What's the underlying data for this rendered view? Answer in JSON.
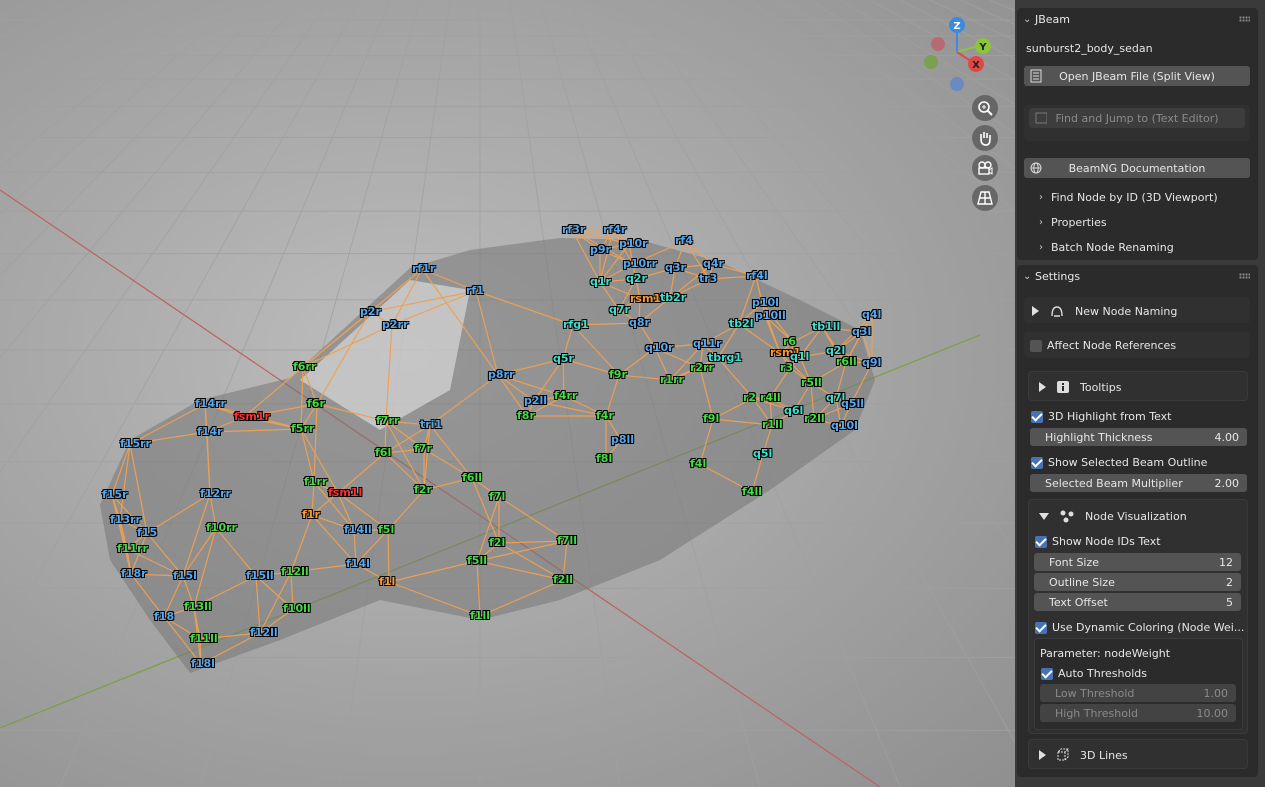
{
  "viewport": {
    "gizmo": {
      "z": "Z",
      "y": "Y",
      "x": "X"
    },
    "node_labels": [
      {
        "t": "rf3r",
        "c": "#58a8f0"
      },
      {
        "t": "rf4r",
        "c": "#58a8f0"
      },
      {
        "t": "p9r",
        "c": "#58a8f0"
      },
      {
        "t": "p10r",
        "c": "#58a8f0"
      },
      {
        "t": "rf4",
        "c": "#58a8f0"
      },
      {
        "t": "rf1r",
        "c": "#58a8f0"
      },
      {
        "t": "p10rr",
        "c": "#58a8f0"
      },
      {
        "t": "q4r",
        "c": "#58a8f0"
      },
      {
        "t": "q3r",
        "c": "#58a8f0"
      },
      {
        "t": "q1r",
        "c": "#40e0d0"
      },
      {
        "t": "q2r",
        "c": "#40e0d0"
      },
      {
        "t": "tr3",
        "c": "#58a8f0"
      },
      {
        "t": "rf4l",
        "c": "#58a8f0"
      },
      {
        "t": "rf1",
        "c": "#58a8f0"
      },
      {
        "t": "rsm1",
        "c": "#ff9a30"
      },
      {
        "t": "tb2r",
        "c": "#40e0d0"
      },
      {
        "t": "p10l",
        "c": "#58a8f0"
      },
      {
        "t": "p2r",
        "c": "#58a8f0"
      },
      {
        "t": "p2rr",
        "c": "#58a8f0"
      },
      {
        "t": "q7r",
        "c": "#40e0d0"
      },
      {
        "t": "rfg1",
        "c": "#40e0d0"
      },
      {
        "t": "q8r",
        "c": "#58a8f0"
      },
      {
        "t": "p10ll",
        "c": "#58a8f0"
      },
      {
        "t": "tb2l",
        "c": "#40e0d0"
      },
      {
        "t": "tb1ll",
        "c": "#40e0d0"
      },
      {
        "t": "q4l",
        "c": "#58a8f0"
      },
      {
        "t": "q3l",
        "c": "#58a8f0"
      },
      {
        "t": "q10r",
        "c": "#58a8f0"
      },
      {
        "t": "q11r",
        "c": "#58a8f0"
      },
      {
        "t": "r6",
        "c": "#44dd44"
      },
      {
        "t": "q2l",
        "c": "#40e0d0"
      },
      {
        "t": "q5r",
        "c": "#40e0d0"
      },
      {
        "t": "tbrg1",
        "c": "#40e0d0"
      },
      {
        "t": "rsm1",
        "c": "#ff9a30"
      },
      {
        "t": "q1l",
        "c": "#40e0d0"
      },
      {
        "t": "r6ll",
        "c": "#44dd44"
      },
      {
        "t": "q9l",
        "c": "#58a8f0"
      },
      {
        "t": "f6rr",
        "c": "#44dd44"
      },
      {
        "t": "p8rr",
        "c": "#58a8f0"
      },
      {
        "t": "f9r",
        "c": "#44dd44"
      },
      {
        "t": "r1rr",
        "c": "#44dd44"
      },
      {
        "t": "r2rr",
        "c": "#44dd44"
      },
      {
        "t": "r3",
        "c": "#44dd44"
      },
      {
        "t": "r5ll",
        "c": "#44dd44"
      },
      {
        "t": "f14rr",
        "c": "#58a8f0"
      },
      {
        "t": "fsm1r",
        "c": "#ff3030"
      },
      {
        "t": "f6r",
        "c": "#44dd44"
      },
      {
        "t": "p2ll",
        "c": "#58a8f0"
      },
      {
        "t": "f4rr",
        "c": "#44dd44"
      },
      {
        "t": "r2",
        "c": "#44dd44"
      },
      {
        "t": "r4ll",
        "c": "#44dd44"
      },
      {
        "t": "q7l",
        "c": "#40e0d0"
      },
      {
        "t": "q5ll",
        "c": "#58a8f0"
      },
      {
        "t": "f14r",
        "c": "#58a8f0"
      },
      {
        "t": "f5rr",
        "c": "#44dd44"
      },
      {
        "t": "f7rr",
        "c": "#44dd44"
      },
      {
        "t": "tri1",
        "c": "#58a8f0"
      },
      {
        "t": "f8r",
        "c": "#44dd44"
      },
      {
        "t": "f4r",
        "c": "#44dd44"
      },
      {
        "t": "f9l",
        "c": "#44dd44"
      },
      {
        "t": "q6l",
        "c": "#40e0d0"
      },
      {
        "t": "r2ll",
        "c": "#44dd44"
      },
      {
        "t": "r1ll",
        "c": "#44dd44"
      },
      {
        "t": "q10l",
        "c": "#58a8f0"
      },
      {
        "t": "f15rr",
        "c": "#58a8f0"
      },
      {
        "t": "f7r",
        "c": "#44dd44"
      },
      {
        "t": "f6l",
        "c": "#44dd44"
      },
      {
        "t": "p8ll",
        "c": "#58a8f0"
      },
      {
        "t": "q5l",
        "c": "#40e0d0"
      },
      {
        "t": "f8l",
        "c": "#44dd44"
      },
      {
        "t": "f4l",
        "c": "#44dd44"
      },
      {
        "t": "f15r",
        "c": "#58a8f0"
      },
      {
        "t": "f12rr",
        "c": "#58a8f0"
      },
      {
        "t": "f1rr",
        "c": "#44dd44"
      },
      {
        "t": "fsm1l",
        "c": "#ff3030"
      },
      {
        "t": "f2r",
        "c": "#44dd44"
      },
      {
        "t": "f6ll",
        "c": "#44dd44"
      },
      {
        "t": "f7l",
        "c": "#44dd44"
      },
      {
        "t": "f4ll",
        "c": "#44dd44"
      },
      {
        "t": "f13rr",
        "c": "#58a8f0"
      },
      {
        "t": "f1r",
        "c": "#ff9a30"
      },
      {
        "t": "f15",
        "c": "#58a8f0"
      },
      {
        "t": "f10rr",
        "c": "#44dd44"
      },
      {
        "t": "f14ll",
        "c": "#58a8f0"
      },
      {
        "t": "f5l",
        "c": "#44dd44"
      },
      {
        "t": "f2l",
        "c": "#44dd44"
      },
      {
        "t": "f7ll",
        "c": "#44dd44"
      },
      {
        "t": "f11rr",
        "c": "#44dd44"
      },
      {
        "t": "f18r",
        "c": "#58a8f0"
      },
      {
        "t": "f15l",
        "c": "#58a8f0"
      },
      {
        "t": "f15ll",
        "c": "#58a8f0"
      },
      {
        "t": "f12ll",
        "c": "#44dd44"
      },
      {
        "t": "f14l",
        "c": "#58a8f0"
      },
      {
        "t": "f1l",
        "c": "#ff9a30"
      },
      {
        "t": "f5ll",
        "c": "#44dd44"
      },
      {
        "t": "f2ll",
        "c": "#44dd44"
      },
      {
        "t": "f18",
        "c": "#58a8f0"
      },
      {
        "t": "f13ll",
        "c": "#44dd44"
      },
      {
        "t": "f10ll",
        "c": "#44dd44"
      },
      {
        "t": "f1ll",
        "c": "#44dd44"
      },
      {
        "t": "f11ll",
        "c": "#44dd44"
      },
      {
        "t": "f12ll",
        "c": "#58a8f0"
      },
      {
        "t": "f18l",
        "c": "#58a8f0"
      }
    ]
  },
  "jbeam_panel": {
    "title": "JBeam",
    "file_name": "sunburst2_body_sedan",
    "open_button": "Open JBeam File (Split View)",
    "find_jump_placeholder": "Find and Jump to (Text Editor)",
    "docs_button": "BeamNG Documentation",
    "collapsed": [
      "Find Node by ID (3D Viewport)",
      "Properties",
      "Batch Node Renaming"
    ]
  },
  "settings_panel": {
    "title": "Settings",
    "new_node_naming": "New Node Naming",
    "affect_node_refs": "Affect Node References",
    "tooltips": "Tooltips",
    "highlight_from_text": "3D Highlight from Text",
    "highlight_thickness_label": "Highlight Thickness",
    "highlight_thickness_value": "4.00",
    "show_selected_outline": "Show Selected Beam Outline",
    "selected_multiplier_label": "Selected Beam Multiplier",
    "selected_multiplier_value": "2.00",
    "node_visualization": "Node Visualization",
    "show_node_ids": "Show Node IDs Text",
    "font_size_label": "Font Size",
    "font_size_value": "12",
    "outline_size_label": "Outline Size",
    "outline_size_value": "2",
    "text_offset_label": "Text Offset",
    "text_offset_value": "5",
    "dynamic_coloring": "Use Dynamic Coloring (Node Wei...",
    "parameter_text": "Parameter: nodeWeight",
    "auto_thresholds": "Auto Thresholds",
    "low_threshold_label": "Low Threshold",
    "low_threshold_value": "1.00",
    "high_threshold_label": "High Threshold",
    "high_threshold_value": "10.00",
    "lines_3d": "3D Lines"
  },
  "colors": {
    "accent": "#4772b3",
    "wire": "#f0a050",
    "axis_x": "#e04848",
    "axis_y": "#8ac53a",
    "axis_z": "#3a8ae0"
  }
}
